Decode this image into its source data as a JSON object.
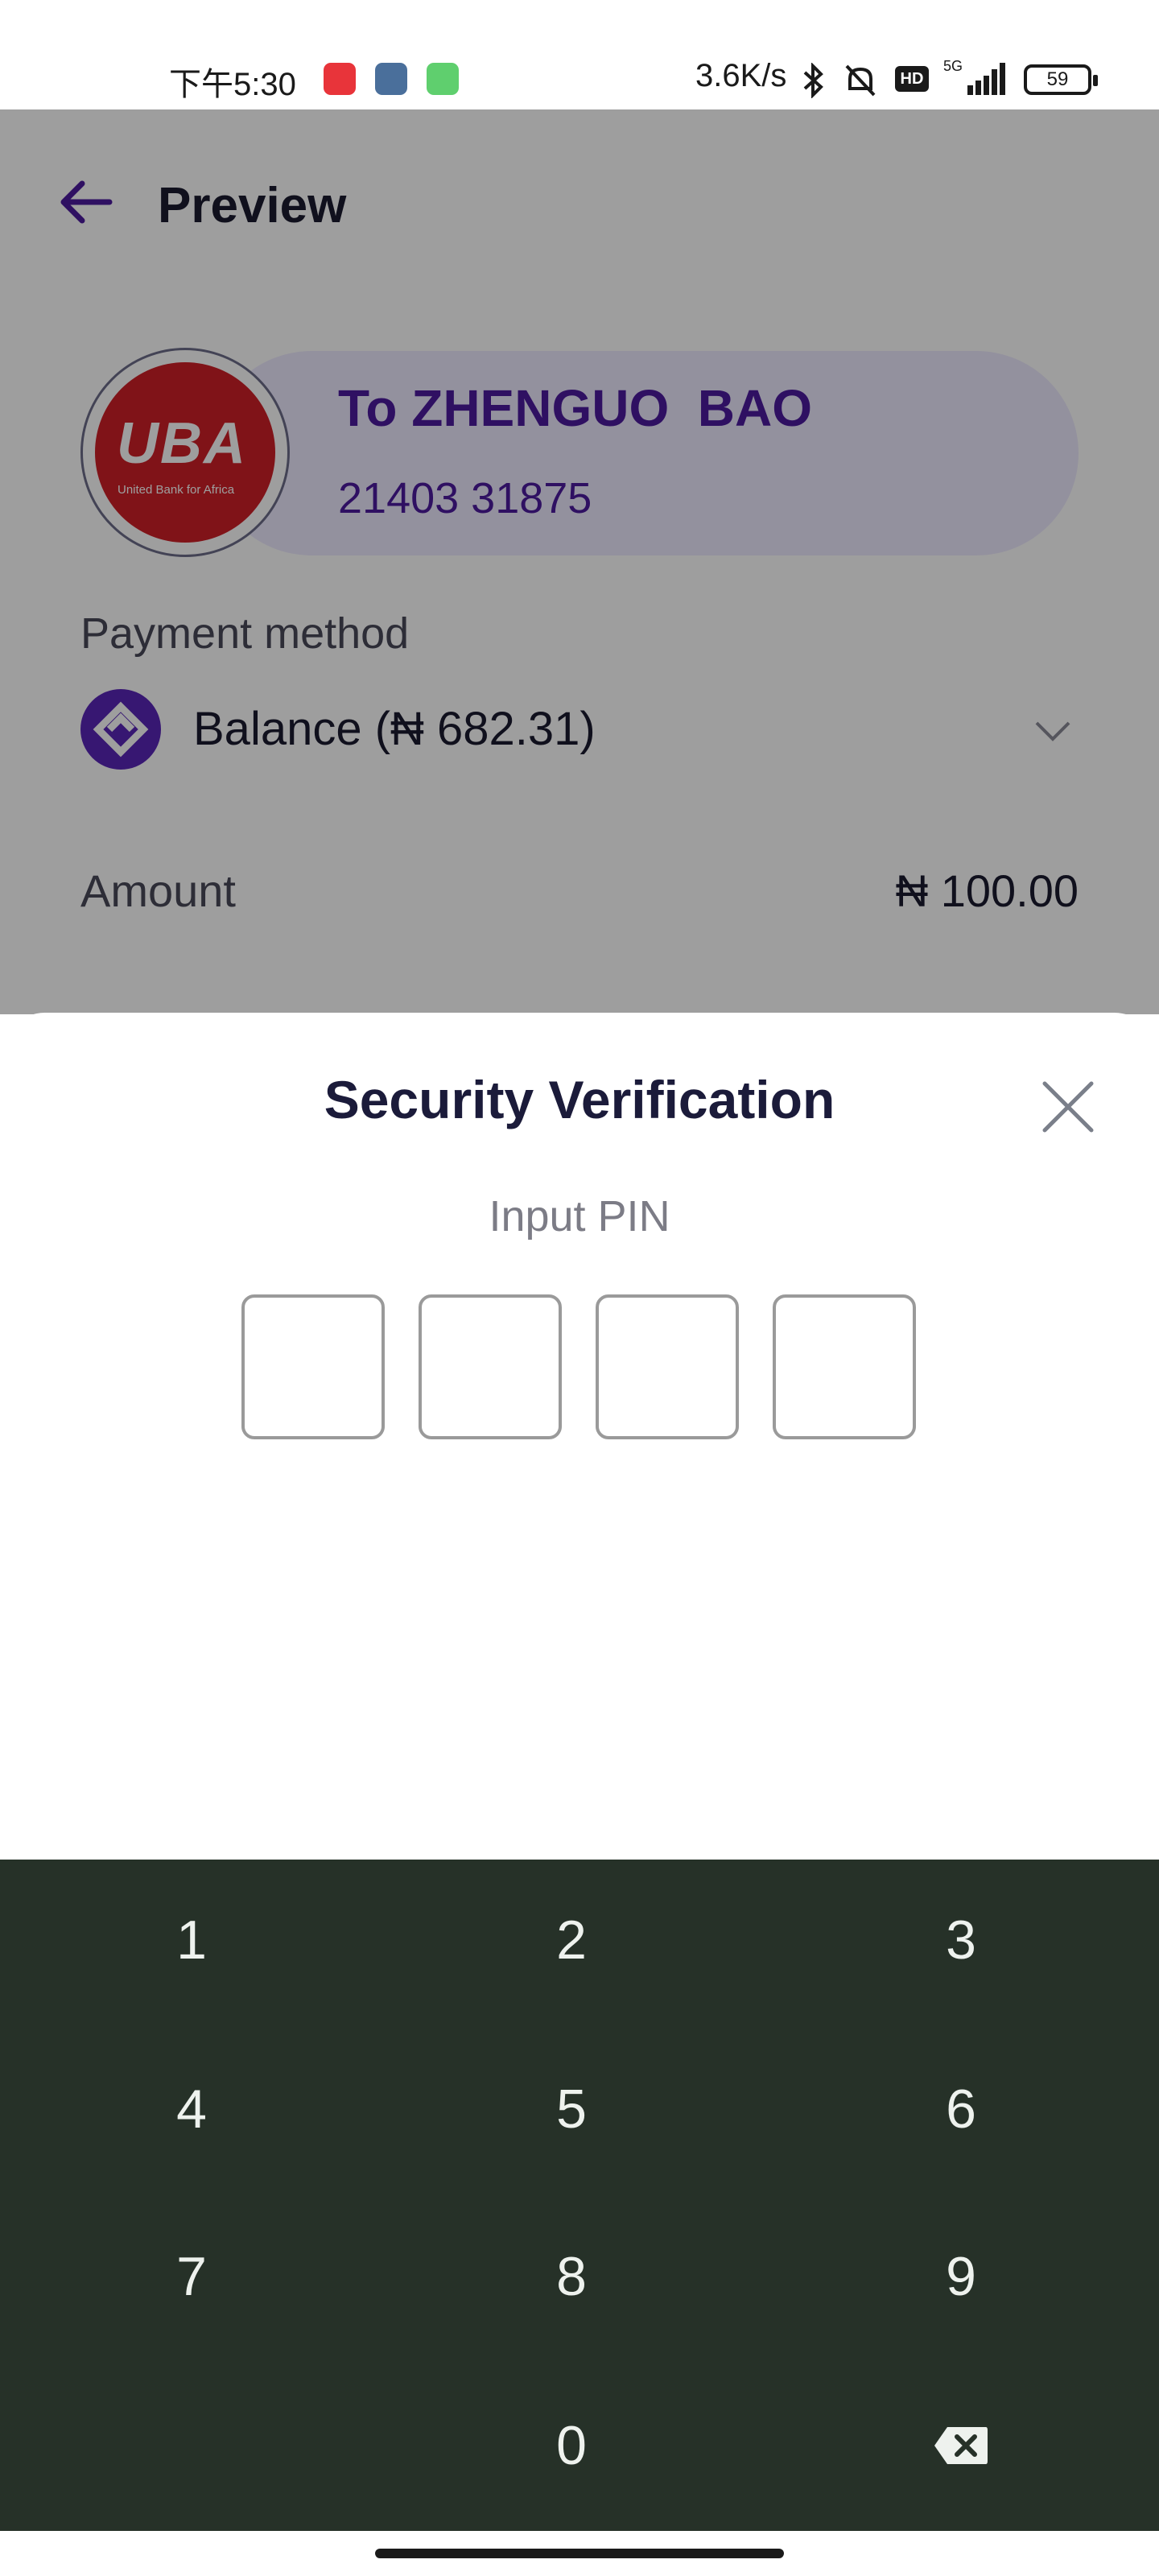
{
  "status_bar": {
    "time": "下午5:30",
    "net_speed": "3.6K/s",
    "hd_badge": "HD",
    "network": "5G",
    "battery": "59"
  },
  "header": {
    "title": "Preview",
    "back_icon": "arrow-left-icon"
  },
  "recipient": {
    "bank_logo_text": "UBA",
    "bank_logo_sub": "United Bank for Africa",
    "name": "To ZHENGUO  BAO",
    "account": "21403 31875"
  },
  "payment_method": {
    "label": "Payment method",
    "value": "Balance (₦ 682.31)",
    "icon": "wallet-logo-icon"
  },
  "amount": {
    "label": "Amount",
    "value": "₦ 100.00"
  },
  "security_sheet": {
    "title": "Security Verification",
    "pin_label": "Input PIN",
    "pin_boxes": [
      "",
      "",
      "",
      ""
    ]
  },
  "keypad": {
    "keys": [
      "1",
      "2",
      "3",
      "4",
      "5",
      "6",
      "7",
      "8",
      "9",
      "0"
    ],
    "backspace_icon": "backspace-icon"
  },
  "colors": {
    "brand_purple": "#4d1b9e",
    "keypad_bg": "#263128",
    "bank_red": "#cf2027"
  }
}
